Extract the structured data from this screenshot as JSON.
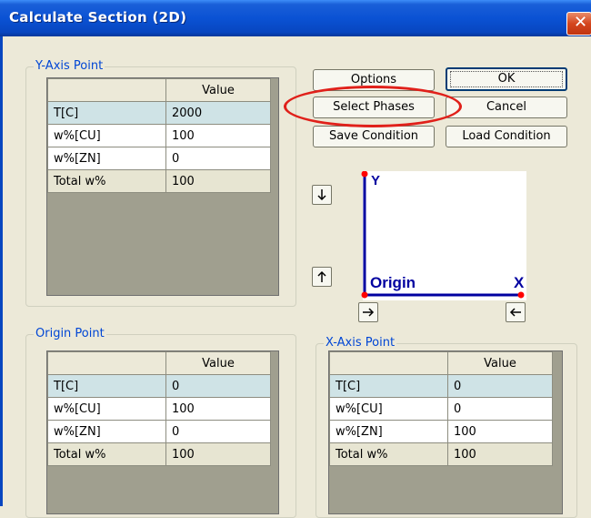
{
  "window": {
    "title": "Calculate Section (2D)",
    "close_glyph": "✕"
  },
  "buttons": {
    "options": "Options",
    "ok": "OK",
    "select_phases": "Select Phases",
    "cancel": "Cancel",
    "save_condition": "Save Condition",
    "load_condition": "Load Condition"
  },
  "y_axis_point": {
    "title": "Y-Axis Point",
    "header": "Value",
    "rows": [
      {
        "label": "T[C]",
        "value": "2000"
      },
      {
        "label": "w%[CU]",
        "value": "100"
      },
      {
        "label": "w%[ZN]",
        "value": "0"
      },
      {
        "label": "Total w%",
        "value": "100"
      }
    ]
  },
  "origin_point": {
    "title": "Origin Point",
    "header": "Value",
    "rows": [
      {
        "label": "T[C]",
        "value": "0"
      },
      {
        "label": "w%[CU]",
        "value": "100"
      },
      {
        "label": "w%[ZN]",
        "value": "0"
      },
      {
        "label": "Total w%",
        "value": "100"
      }
    ]
  },
  "x_axis_point": {
    "title": "X-Axis Point",
    "header": "Value",
    "rows": [
      {
        "label": "T[C]",
        "value": "0"
      },
      {
        "label": "w%[CU]",
        "value": "0"
      },
      {
        "label": "w%[ZN]",
        "value": "100"
      },
      {
        "label": "Total w%",
        "value": "100"
      }
    ]
  },
  "diagram": {
    "y_label": "Y",
    "x_label": "X",
    "origin_label": "Origin",
    "axis_color": "#0000a0",
    "point_color": "#ff0000"
  },
  "highlight_color": "#e0201a"
}
